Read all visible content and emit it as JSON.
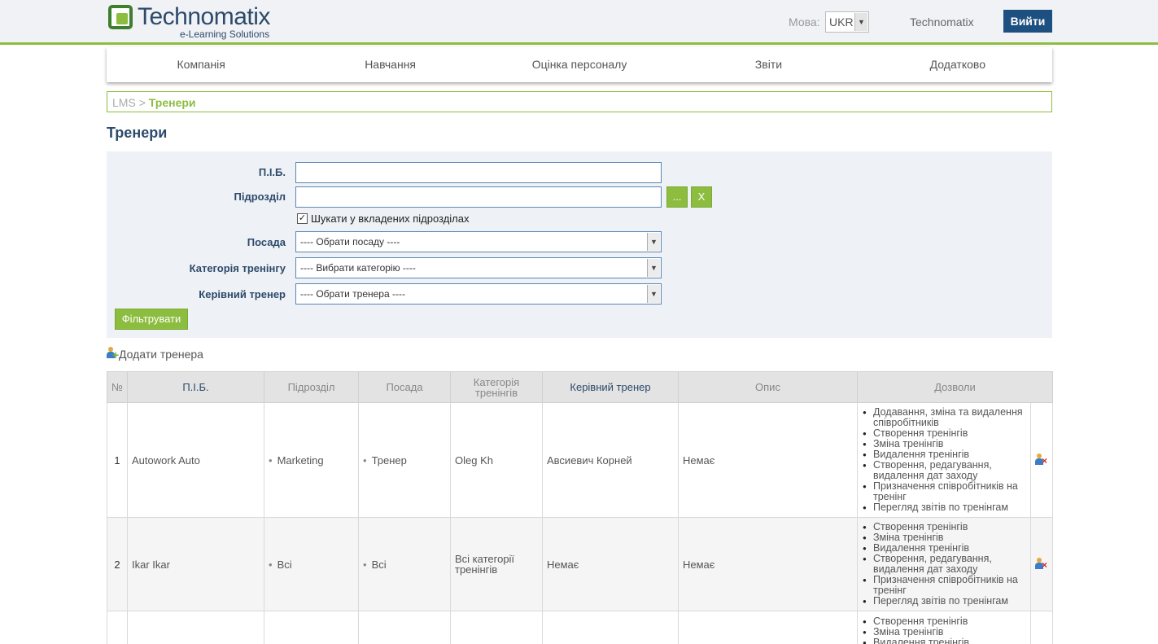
{
  "header": {
    "logo_text": "Technomatix",
    "logo_subtitle": "e-Learning Solutions",
    "language_label": "Мова:",
    "language_value": "UKR",
    "user_name": "Technomatix",
    "logout_label": "Вийти",
    "accent_color": "#8cbd3f",
    "brand_color": "#2d4a6b"
  },
  "nav": {
    "items": [
      "Компанія",
      "Навчання",
      "Оцінка персоналу",
      "Звіти",
      "Додатково"
    ]
  },
  "breadcrumb": {
    "root": "LMS",
    "separator": ">",
    "current": "Тренери"
  },
  "page": {
    "title": "Тренери"
  },
  "filter": {
    "name_label": "П.І.Б.",
    "name_value": "",
    "department_label": "Підрозділ",
    "department_value": "",
    "browse_button": "...",
    "clear_button": "X",
    "nested_checkbox_label": "Шукати у вкладених підрозділах",
    "nested_checked": true,
    "position_label": "Посада",
    "position_value": "---- Обрати посаду ----",
    "category_label": "Категорія тренінгу",
    "category_value": "---- Вибрати категорію ----",
    "lead_label": "Керівний тренер",
    "lead_value": "---- Обрати тренера ----",
    "filter_button": "Фільтрувати"
  },
  "actions": {
    "add_trainer": "Додати тренера"
  },
  "table": {
    "headers": [
      "№",
      "П.І.Б.",
      "Підрозділ",
      "Посада",
      "Категорія тренінгів",
      "Керівний тренер",
      "Опис",
      "Дозволи"
    ],
    "rows": [
      {
        "num": "1",
        "name": "Autowork Auto",
        "department": "Marketing",
        "position": "Тренер",
        "category": "Oleg Kh",
        "lead": "Авсиевич Корней",
        "description": "Немає",
        "permissions": [
          "Додавання, зміна та видалення співробітників",
          "Створення тренінгів",
          "Зміна тренінгів",
          "Видалення тренінгів",
          "Створення, редагування, видалення дат заходу",
          "Призначення співробітників на тренінг",
          "Перегляд звітів по тренінгам"
        ]
      },
      {
        "num": "2",
        "name": "Ikar Ikar",
        "department": "Всі",
        "position": "Всі",
        "category": "Всі категорії тренінгів",
        "lead": "Немає",
        "description": "Немає",
        "permissions": [
          "Створення тренінгів",
          "Зміна тренінгів",
          "Видалення тренінгів",
          "Створення, редагування, видалення дат заходу",
          "Призначення співробітників на тренінг",
          "Перегляд звітів по тренінгам"
        ]
      },
      {
        "num": "",
        "name": "",
        "department": "",
        "position": "",
        "category": "",
        "lead": "",
        "description": "",
        "permissions": [
          "Створення тренінгів",
          "Зміна тренінгів",
          "Видалення тренінгів"
        ]
      }
    ]
  }
}
